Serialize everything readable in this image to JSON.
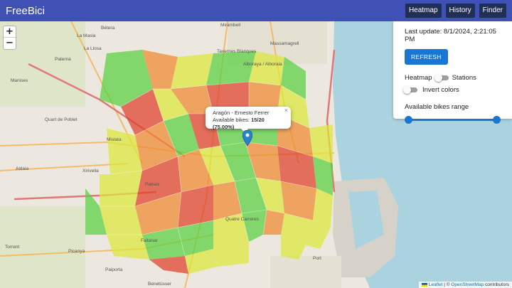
{
  "app": {
    "title": "FreeBici",
    "buttons": [
      "Heatmap",
      "History",
      "Finder"
    ]
  },
  "map": {
    "zoom_in": "+",
    "zoom_out": "−",
    "labels": [
      "Bétera",
      "Mirambell",
      "La Masia",
      "La Llosa",
      "Massamagrell",
      "Paterna",
      "Tavernes Blanques",
      "Manises",
      "Alboraya / Alboraia",
      "Quart de Poblet",
      "Mislata",
      "Aldaia",
      "Xirivella",
      "Patraix",
      "Quatre Carreres",
      "Faitanar",
      "Torrent",
      "Picanya",
      "Paiporta",
      "Port",
      "Benetússer"
    ],
    "attribution": {
      "leaflet": "Leaflet",
      "separator": "| ©",
      "osm": "OpenStreetMap",
      "suffix": "contributors"
    }
  },
  "popup": {
    "station": "Aragón - Ernesto Ferrer",
    "label": "Available bikes:",
    "value": "15/20 (75.00%)",
    "close": "×"
  },
  "panel": {
    "last_update": "Last update: 8/1/2024, 2:21:05 PM",
    "refresh_label": "REFRESH",
    "heatmap_label": "Heatmap",
    "stations_label": "Stations",
    "invert_label": "Invert colors",
    "range_label": "Available bikes range",
    "range_min_fraction": 0,
    "range_max_fraction": 1
  },
  "colors": {
    "navbar": "#3f51b5",
    "button_dark": "#1f2f55",
    "accent": "#1976d2",
    "water": "#aad3df",
    "heat_green": "#59d13f",
    "heat_yellow": "#dde83a",
    "heat_orange": "#f08a30",
    "heat_red": "#e0402a"
  }
}
